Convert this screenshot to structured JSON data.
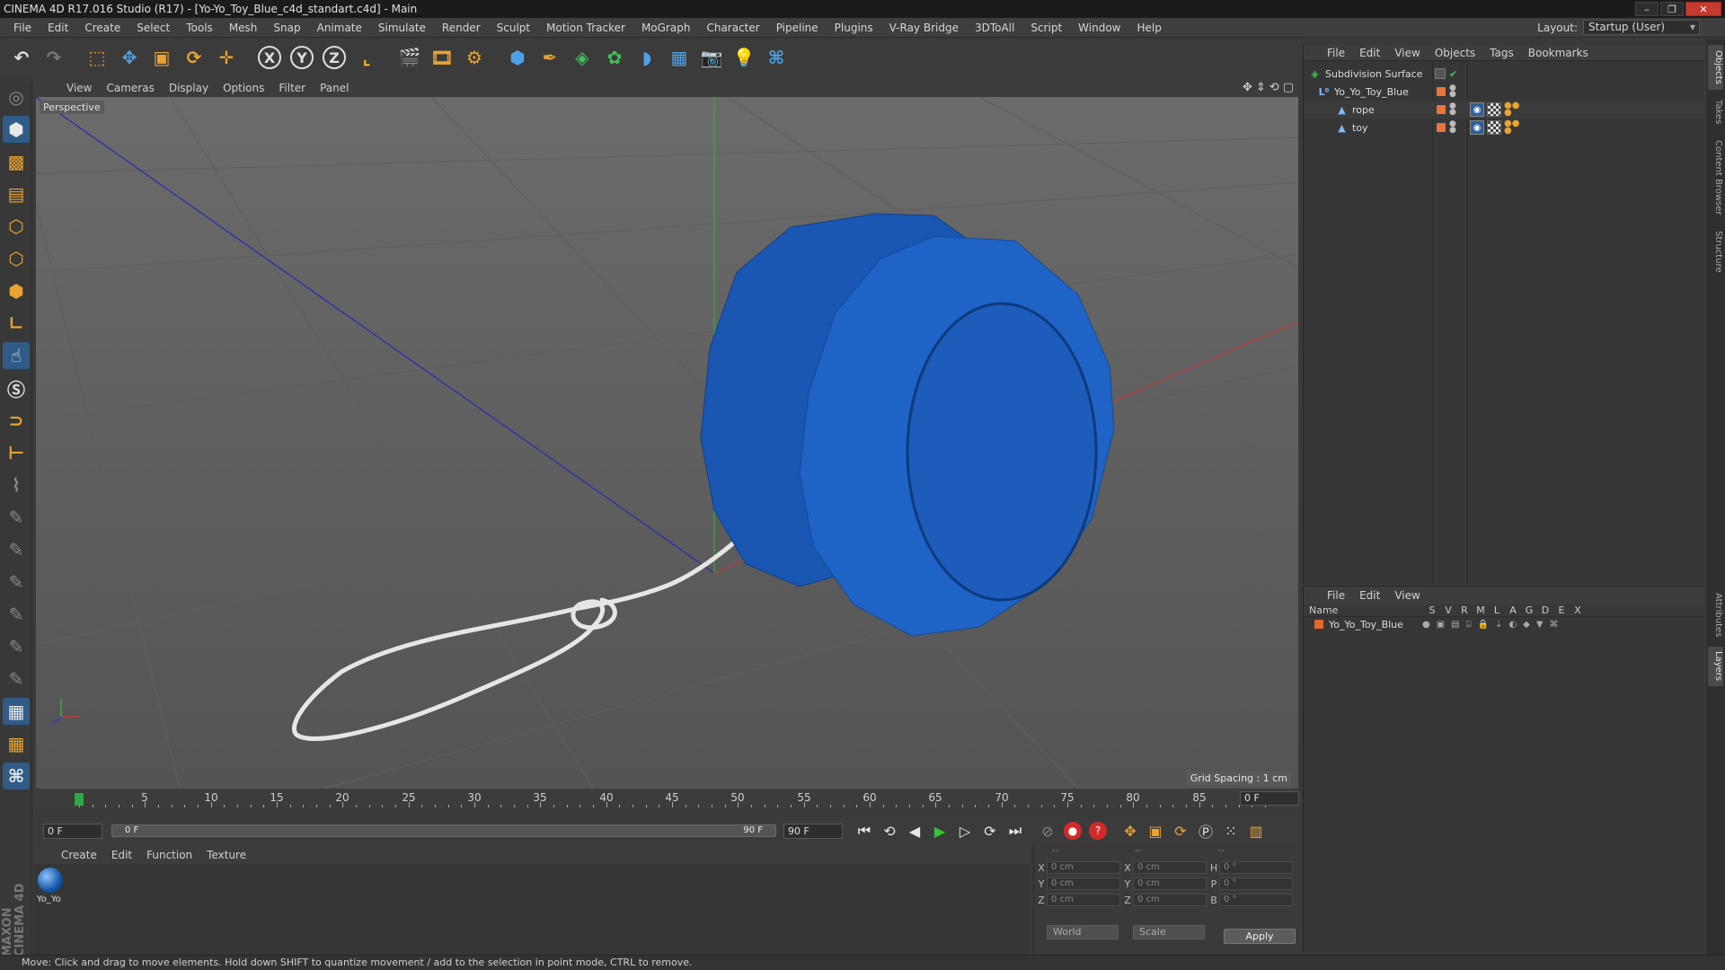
{
  "window": {
    "title": "CINEMA 4D R17.016 Studio (R17) - [Yo-Yo_Toy_Blue_c4d_standart.c4d] - Main",
    "buttons": [
      "–",
      "❐",
      "✕"
    ]
  },
  "menubar": {
    "items": [
      "File",
      "Edit",
      "Create",
      "Select",
      "Tools",
      "Mesh",
      "Snap",
      "Animate",
      "Simulate",
      "Render",
      "Sculpt",
      "Motion Tracker",
      "MoGraph",
      "Character",
      "Pipeline",
      "Plugins",
      "V-Ray Bridge",
      "3DToAll",
      "Script",
      "Window",
      "Help"
    ],
    "layout_label": "Layout:",
    "layout_value": "Startup (User)"
  },
  "toolbar": {
    "axis_x": "X",
    "axis_y": "Y",
    "axis_z": "Z"
  },
  "viewport": {
    "menu": [
      "View",
      "Cameras",
      "Display",
      "Options",
      "Filter",
      "Panel"
    ],
    "label": "Perspective",
    "grid_spacing": "Grid Spacing : 1 cm"
  },
  "timeline": {
    "ticks": [
      "0",
      "5",
      "10",
      "15",
      "20",
      "25",
      "30",
      "35",
      "40",
      "45",
      "50",
      "55",
      "60",
      "65",
      "70",
      "75",
      "80",
      "85",
      "90"
    ],
    "current_frame": "0 F",
    "start_field": "0 F",
    "slider_start": "0 F",
    "slider_end": "90 F",
    "end_field": "90 F"
  },
  "materials": {
    "menu": [
      "Create",
      "Edit",
      "Function",
      "Texture"
    ],
    "items": [
      {
        "name": "Yo_Yo"
      }
    ]
  },
  "coordinates": {
    "header": [
      "--",
      "--",
      "--"
    ],
    "rows": [
      {
        "l1": "X",
        "v1": "0 cm",
        "l2": "X",
        "v2": "0 cm",
        "l3": "H",
        "v3": "0 °"
      },
      {
        "l1": "Y",
        "v1": "0 cm",
        "l2": "Y",
        "v2": "0 cm",
        "l3": "P",
        "v3": "0 °"
      },
      {
        "l1": "Z",
        "v1": "0 cm",
        "l2": "Z",
        "v2": "0 cm",
        "l3": "B",
        "v3": "0 °"
      }
    ],
    "space": "World",
    "mode": "Scale",
    "apply": "Apply"
  },
  "object_manager": {
    "menu": [
      "File",
      "Edit",
      "View",
      "Objects",
      "Tags",
      "Bookmarks"
    ],
    "objects": [
      {
        "name": "Subdivision Surface",
        "icon_color": "#39c247"
      },
      {
        "name": "Yo_Yo_Toy_Blue",
        "icon_color": "#7fb7ff"
      },
      {
        "name": "rope",
        "icon_color": "#7fb7ff"
      },
      {
        "name": "toy",
        "icon_color": "#7fb7ff"
      }
    ]
  },
  "layer_manager": {
    "menu": [
      "File",
      "Edit",
      "View"
    ],
    "columns": [
      "Name",
      "S",
      "V",
      "R",
      "M",
      "L",
      "A",
      "G",
      "D",
      "E",
      "X"
    ],
    "layers": [
      {
        "name": "Yo_Yo_Toy_Blue",
        "color": "#e0692a"
      }
    ]
  },
  "side_tabs": [
    "Objects",
    "Takes",
    "Content Browser",
    "Structure",
    "Attributes",
    "Layers"
  ],
  "status": {
    "text": "Move: Click and drag to move elements. Hold down SHIFT to quantize movement / add to the selection in point mode, CTRL to remove."
  },
  "colors": {
    "yoyo_blue": "#1f5fbf",
    "accent_orange": "#e8a331"
  }
}
